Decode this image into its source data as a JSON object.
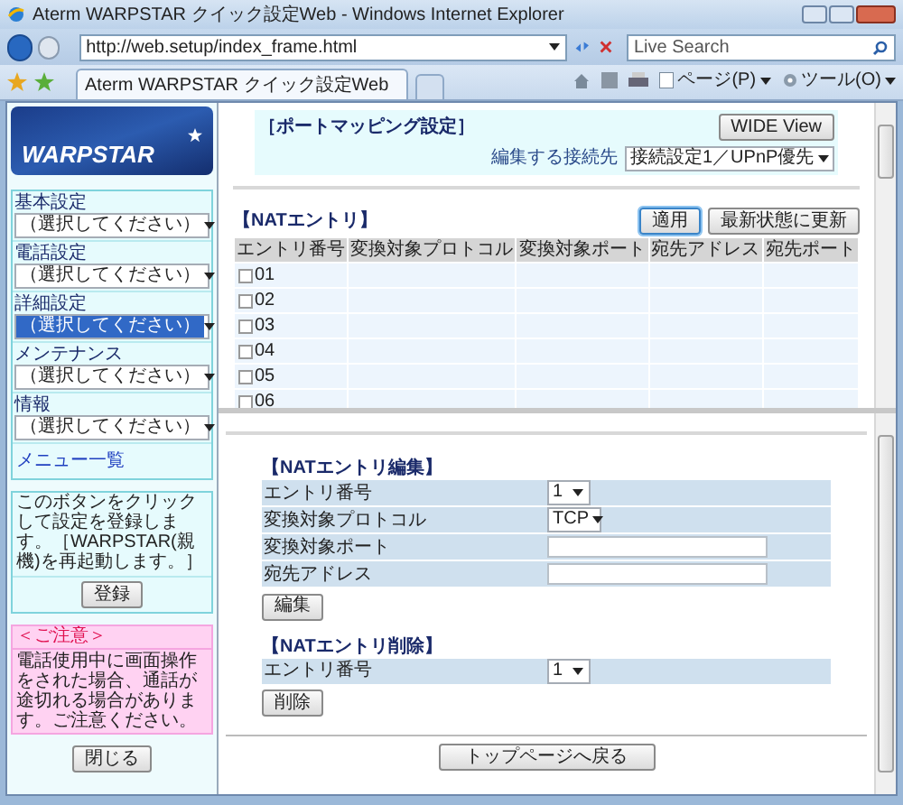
{
  "window": {
    "title": "Aterm WARPSTAR クイック設定Web - Windows Internet Explorer"
  },
  "address_bar": {
    "url": "http://web.setup/index_frame.html"
  },
  "search": {
    "placeholder": "Live Search"
  },
  "tabs": [
    {
      "label": "Aterm WARPSTAR クイック設定Web",
      "selected": true
    }
  ],
  "toolbar": [
    {
      "kind": "page",
      "label": "ページ(P)"
    },
    {
      "kind": "tools",
      "label": "ツール(O)"
    }
  ],
  "sidebar": {
    "logo_text": "WARPSTAR",
    "menus": [
      {
        "label": "基本設定",
        "value": "（選択してください）",
        "highlighted": false
      },
      {
        "label": "電話設定",
        "value": "（選択してください）",
        "highlighted": false
      },
      {
        "label": "詳細設定",
        "value": "（選択してください）",
        "highlighted": true
      },
      {
        "label": "メンテナンス",
        "value": "（選択してください）",
        "highlighted": false
      },
      {
        "label": "情報",
        "value": "（選択してください）",
        "highlighted": false
      }
    ],
    "link": "メニュー一覧",
    "register_note": "このボタンをクリックして設定を登録します。［WARPSTAR(親機)を再起動します。］",
    "register_button": "登録",
    "notice_title": "＜ご注意＞",
    "notice_text": "電話使用中に画面操作をされた場合、通話が途切れる場合があります。ご注意ください。",
    "close_button": "閉じる"
  },
  "port_mapping": {
    "title": "［ポートマッピング設定］",
    "wide_view_button": "WIDE View",
    "target_label": "編集する接続先",
    "target_value": "接続設定1／UPnP優先"
  },
  "nat_entries": {
    "title": "【NATエントリ】",
    "buttons": [
      {
        "label": "適用",
        "focused": true
      },
      {
        "label": "最新状態に更新",
        "focused": false
      }
    ],
    "columns": [
      "エントリ番号",
      "変換対象プロトコル",
      "変換対象ポート",
      "宛先アドレス",
      "宛先ポート"
    ],
    "rows": [
      {
        "number": "01",
        "checked": false
      },
      {
        "number": "02",
        "checked": false
      },
      {
        "number": "03",
        "checked": false
      },
      {
        "number": "04",
        "checked": false
      },
      {
        "number": "05",
        "checked": false
      },
      {
        "number": "06",
        "checked": false
      }
    ]
  },
  "nat_edit": {
    "title": "【NATエントリ編集】",
    "fields": [
      {
        "kind": "select",
        "label": "エントリ番号",
        "value": "1"
      },
      {
        "kind": "select",
        "label": "変換対象プロトコル",
        "value": "TCP"
      },
      {
        "kind": "text",
        "label": "変換対象ポート"
      },
      {
        "kind": "text",
        "label": "宛先アドレス"
      }
    ],
    "button": "編集"
  },
  "nat_delete": {
    "title": "【NATエントリ削除】",
    "fields": [
      {
        "kind": "select",
        "label": "エントリ番号",
        "value": "1"
      }
    ],
    "button": "削除"
  },
  "back_button": "トップページへ戻る"
}
